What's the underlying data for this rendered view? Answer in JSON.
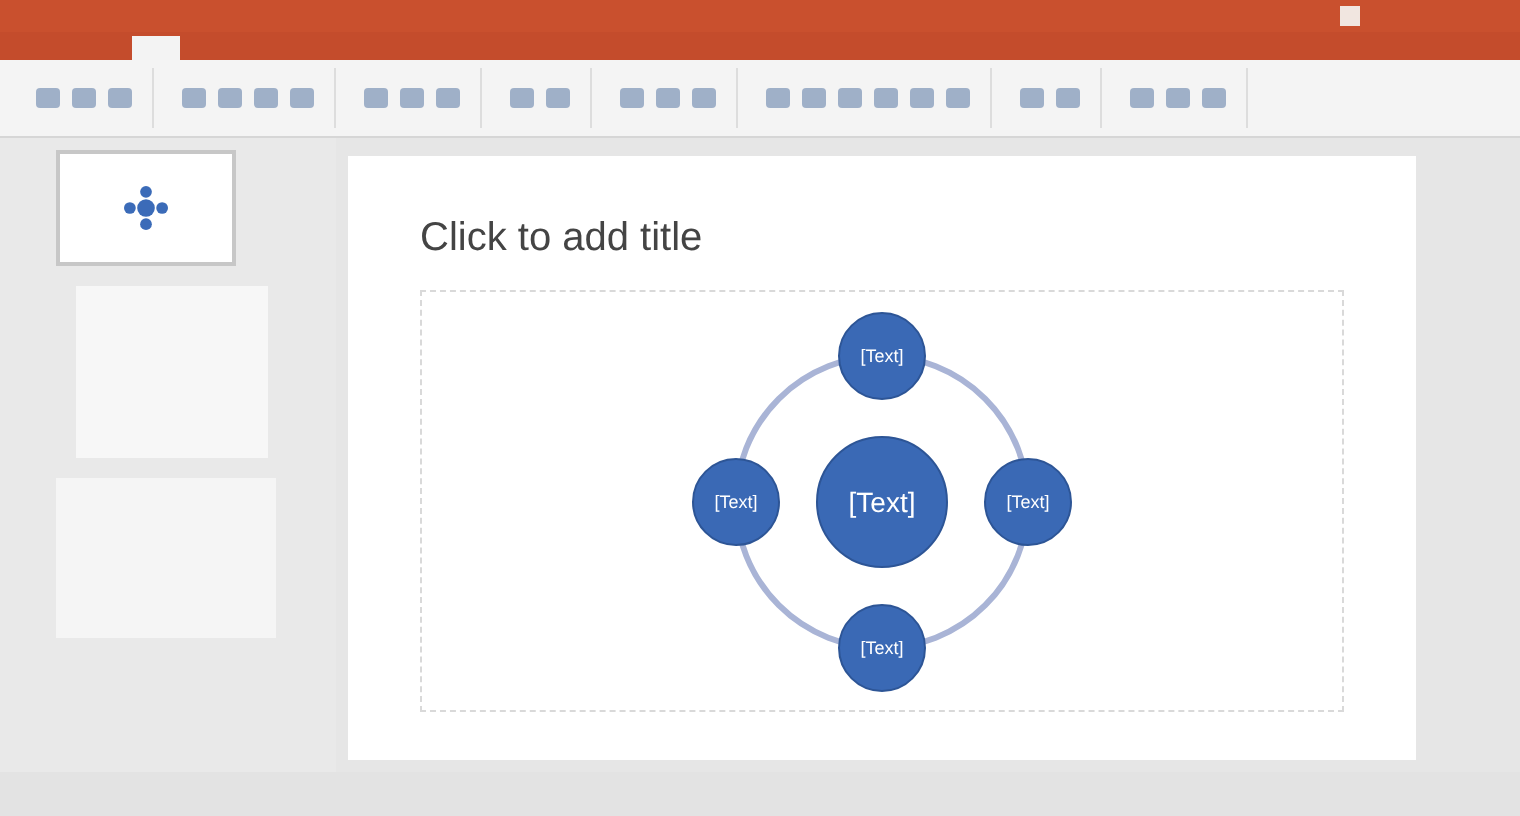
{
  "slide": {
    "title_placeholder": "Click to add title",
    "diagram": {
      "center": "[Text]",
      "satellites": [
        {
          "text": "[Text]"
        },
        {
          "text": "[Text]"
        },
        {
          "text": "[Text]"
        },
        {
          "text": "[Text]"
        }
      ]
    }
  }
}
